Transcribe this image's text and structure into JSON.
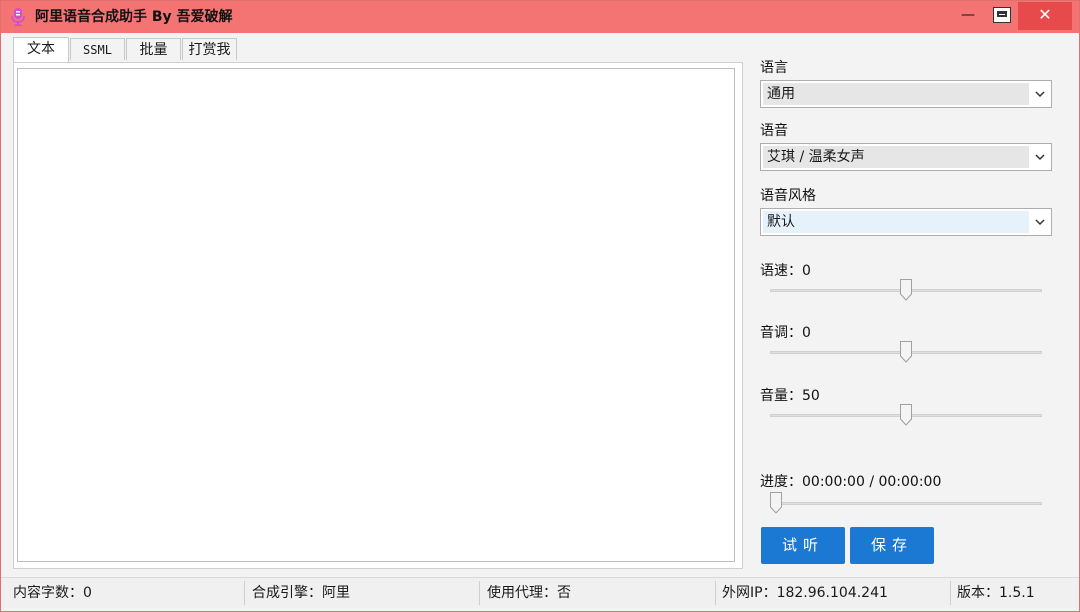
{
  "window": {
    "title": "阿里语音合成助手 By 吾爱破解",
    "minimize": "—",
    "close": "✕"
  },
  "tabs": [
    {
      "label": "文本",
      "active": true
    },
    {
      "label": "SSML",
      "active": false
    },
    {
      "label": "批量",
      "active": false
    },
    {
      "label": "打赏我",
      "active": false
    }
  ],
  "editor": {
    "value": "",
    "placeholder": ""
  },
  "settings": {
    "language": {
      "label": "语言",
      "value": "通用"
    },
    "voice": {
      "label": "语音",
      "value": "艾琪 / 温柔女声"
    },
    "style": {
      "label": "语音风格",
      "value": "默认"
    },
    "speed": {
      "label": "语速：0",
      "value": 0,
      "min": -500,
      "max": 500
    },
    "pitch": {
      "label": "音调：0",
      "value": 0,
      "min": -500,
      "max": 500
    },
    "volume": {
      "label": "音量：50",
      "value": 50,
      "min": 0,
      "max": 100
    },
    "progress": {
      "label": "进度：00:00:00 / 00:00:00",
      "fraction": 0
    }
  },
  "actions": {
    "preview": "试听",
    "save": "保存"
  },
  "status": {
    "chars": "内容字数：0",
    "engine": "合成引擎：阿里",
    "proxy": "使用代理：否",
    "ip": "外网IP：182.96.104.241",
    "version": "版本：1.5.1"
  },
  "colors": {
    "titlebar": "#f47474",
    "close": "#e64a4a",
    "accent": "#1b78d3"
  },
  "icons": {
    "app": "microphone-icon",
    "dropdown": "chevron-down-icon",
    "maximize": "maximize-icon"
  }
}
